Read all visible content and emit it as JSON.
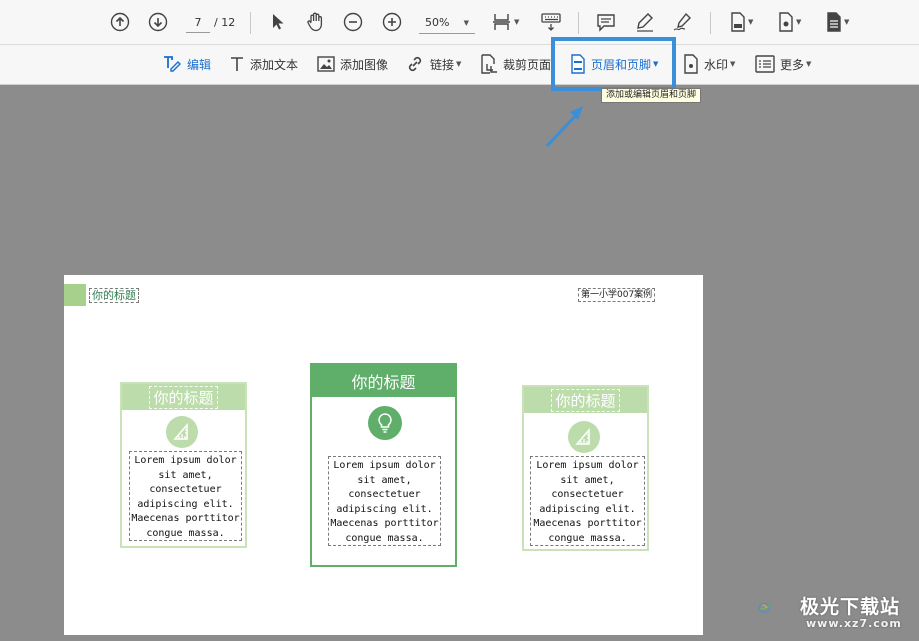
{
  "toolbar": {
    "page_current": "7",
    "page_total": "/ 12",
    "zoom": "50%"
  },
  "edit_toolbar": {
    "items": [
      {
        "label": "编辑"
      },
      {
        "label": "添加文本"
      },
      {
        "label": "添加图像"
      },
      {
        "label": "链接"
      },
      {
        "label": "裁剪页面"
      },
      {
        "label": "页眉和页脚"
      },
      {
        "label": "水印"
      },
      {
        "label": "更多"
      }
    ],
    "tooltip": "添加或编辑页眉和页脚"
  },
  "document": {
    "header_title": "你的标题",
    "header_right": "第一小学007案例",
    "cards": [
      {
        "title": "你的标题",
        "body": [
          "Lorem ipsum dolor",
          "sit amet,",
          "consectetuer",
          "adipiscing elit.",
          "Maecenas porttitor",
          "congue massa."
        ]
      },
      {
        "title": "你的标题",
        "body": [
          "Lorem ipsum dolor",
          "sit amet,",
          "consectetuer",
          "adipiscing elit.",
          "Maecenas porttitor",
          "congue massa."
        ]
      },
      {
        "title": "你的标题",
        "body": [
          "Lorem ipsum dolor",
          "sit amet,",
          "consectetuer",
          "adipiscing elit.",
          "Maecenas porttitor",
          "congue massa."
        ]
      }
    ]
  },
  "watermark": {
    "name": "极光下载站",
    "url": "www.xz7.com"
  },
  "colors": {
    "accent_blue": "#3b8fd9",
    "card_light_green": "#a8d08d",
    "card_dark_green": "#5fae6a"
  }
}
